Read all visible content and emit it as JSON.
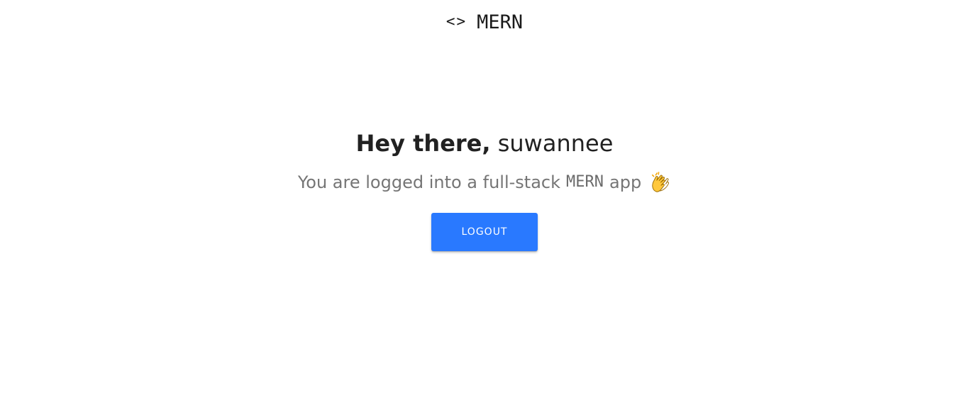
{
  "header": {
    "brand_icon": "<>",
    "brand_name": "MERN",
    "icon_name": "code-brackets-icon"
  },
  "main": {
    "greeting_prefix": "Hey there,",
    "username": "suwannee",
    "subtitle_before": "You are logged into a full-stack",
    "subtitle_mono": "MERN",
    "subtitle_after": "app",
    "emoji_icon": "clapping-hands-icon",
    "logout_label": "Logout"
  },
  "colors": {
    "accent": "#2979ff",
    "text_primary": "#212121",
    "text_secondary": "#757575",
    "background": "#ffffff"
  }
}
